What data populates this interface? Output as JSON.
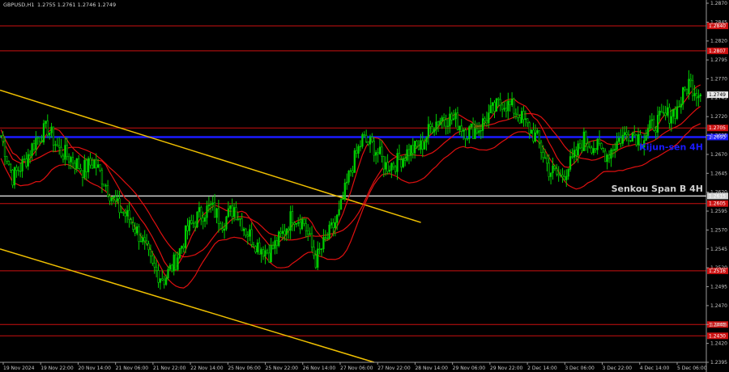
{
  "header": {
    "symbol": "GBPUSD,H1",
    "ohlc": "1.2755 1.2761 1.2746 1.2749"
  },
  "colors": {
    "background": "#000000",
    "candle_up": "#00d000",
    "candle_down": "#00d000",
    "ichimoku_lines": "#e01010",
    "support_resistance": "#cc1111",
    "kijun_4h": "#1a1aff",
    "senkou_b_4h": "#d0d0d0",
    "channel": "#f0c000"
  },
  "chart_data": {
    "type": "candlestick",
    "ylim": [
      1.2395,
      1.287
    ],
    "y_ticks": [
      "1.2870",
      "1.2845",
      "1.2820",
      "1.2795",
      "1.2770",
      "1.2745",
      "1.2720",
      "1.2695",
      "1.2670",
      "1.2645",
      "1.2620",
      "1.2595",
      "1.2570",
      "1.2545",
      "1.2520",
      "1.2495",
      "1.2470",
      "1.2445",
      "1.2420",
      "1.2395"
    ],
    "x_ticks": [
      "19 Nov 2024",
      "19 Nov 22:00",
      "20 Nov 14:00",
      "21 Nov 06:00",
      "21 Nov 22:00",
      "22 Nov 14:00",
      "25 Nov 06:00",
      "25 Nov 22:00",
      "26 Nov 14:00",
      "27 Nov 06:00",
      "27 Nov 22:00",
      "28 Nov 14:00",
      "29 Nov 06:00",
      "29 Nov 22:00",
      "2 Dec 14:00",
      "3 Dec 06:00",
      "3 Dec 22:00",
      "4 Dec 14:00",
      "5 Dec 06:00"
    ],
    "current_price": "1.2749",
    "levels": [
      {
        "price": 1.284,
        "label": "1.2840",
        "kind": "support_resistance"
      },
      {
        "price": 1.2807,
        "label": "1.2807",
        "kind": "support_resistance"
      },
      {
        "price": 1.2705,
        "label": "1.2705",
        "kind": "support_resistance"
      },
      {
        "price": 1.2693,
        "label": "1.2693",
        "kind": "kijun_4h"
      },
      {
        "price": 1.2615,
        "label": "1.2615",
        "kind": "senkou_b_4h"
      },
      {
        "price": 1.2605,
        "label": "1.2605",
        "kind": "support_resistance"
      },
      {
        "price": 1.2516,
        "label": "1.2516",
        "kind": "support_resistance"
      },
      {
        "price": 1.2445,
        "label": "1.2445",
        "kind": "support_resistance"
      },
      {
        "price": 1.243,
        "label": "1.2430",
        "kind": "support_resistance"
      }
    ],
    "annotations": [
      {
        "text": "Kijun-sen 4H",
        "price": 1.268
      },
      {
        "text": "Senkou Span B 4H",
        "price": 1.2625
      }
    ],
    "channel_lines": [
      {
        "from": [
          0,
          1.2755
        ],
        "to": [
          36,
          1.258
        ]
      },
      {
        "from": [
          0,
          1.2545
        ],
        "to": [
          32,
          1.2395
        ]
      }
    ],
    "price_path": [
      1.2695,
      1.264,
      1.266,
      1.269,
      1.2705,
      1.2675,
      1.2665,
      1.265,
      1.266,
      1.263,
      1.26,
      1.2585,
      1.256,
      1.252,
      1.2505,
      1.253,
      1.257,
      1.259,
      1.26,
      1.258,
      1.26,
      1.257,
      1.255,
      1.254,
      1.256,
      1.259,
      1.258,
      1.253,
      1.256,
      1.259,
      1.265,
      1.269,
      1.268,
      1.2655,
      1.266,
      1.2675,
      1.268,
      1.271,
      1.272,
      1.2715,
      1.27,
      1.2705,
      1.2725,
      1.274,
      1.273,
      1.271,
      1.269,
      1.265,
      1.264,
      1.266,
      1.269,
      1.268,
      1.267,
      1.269,
      1.27,
      1.269,
      1.271,
      1.272,
      1.273,
      1.2765,
      1.2749
    ]
  }
}
